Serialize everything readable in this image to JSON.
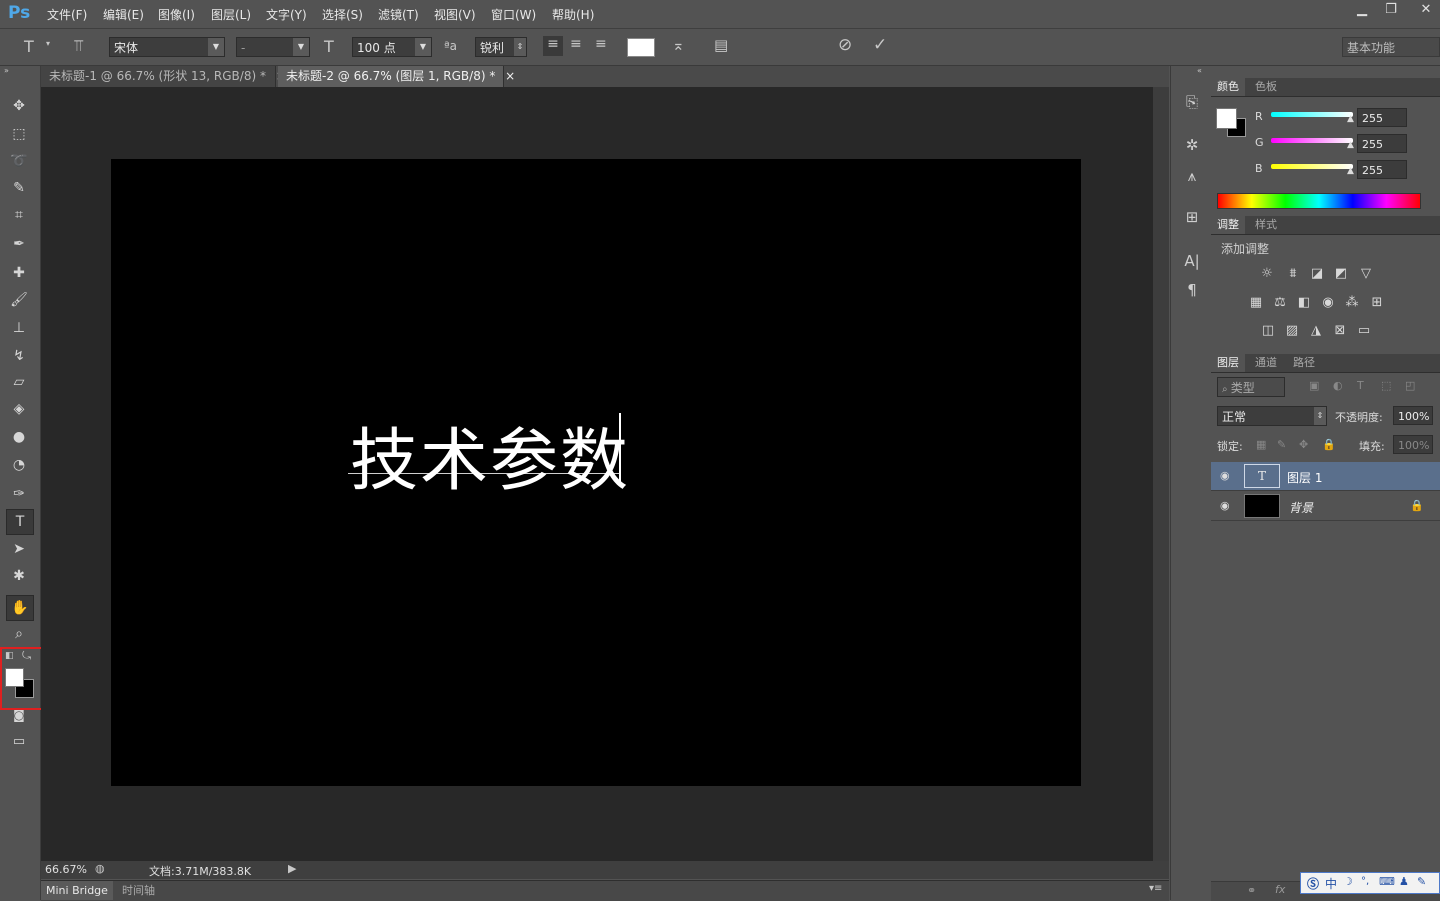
{
  "app": {
    "logo": "Ps"
  },
  "menu": [
    "文件(F)",
    "编辑(E)",
    "图像(I)",
    "图层(L)",
    "文字(Y)",
    "选择(S)",
    "滤镜(T)",
    "视图(V)",
    "窗口(W)",
    "帮助(H)"
  ],
  "window_controls": {
    "minimize": "▁",
    "restore": "❐",
    "close": "✕"
  },
  "options": {
    "font_family": "宋体",
    "font_style": "-",
    "font_size": "100 点",
    "anti_alias_label": "ªa",
    "anti_alias": "锐利",
    "text_color": "#ffffff",
    "workspace": "基本功能"
  },
  "tabs": [
    {
      "label": "未标题-1 @ 66.7% (形状 13, RGB/8) *",
      "close": "×"
    },
    {
      "label": "未标题-2 @ 66.7% (图层 1, RGB/8) *",
      "close": "×"
    }
  ],
  "canvas": {
    "text": "技术参数",
    "background": "#000000"
  },
  "status": {
    "zoom": "66.67%",
    "doc_info": "文档:3.71M/383.8K"
  },
  "bottom_tabs": [
    "Mini Bridge",
    "时间轴"
  ],
  "color_panel": {
    "tabs": [
      "颜色",
      "色板"
    ],
    "foreground": "#ffffff",
    "background": "#000000",
    "channels": [
      {
        "label": "R",
        "value": "255"
      },
      {
        "label": "G",
        "value": "255"
      },
      {
        "label": "B",
        "value": "255"
      }
    ]
  },
  "adjustments_panel": {
    "tabs": [
      "调整",
      "样式"
    ],
    "heading": "添加调整"
  },
  "layers_panel": {
    "tabs": [
      "图层",
      "通道",
      "路径"
    ],
    "filter_label": "类型",
    "blend_mode": "正常",
    "opacity_label": "不透明度:",
    "opacity": "100%",
    "lock_label": "锁定:",
    "fill_label": "填充:",
    "fill": "100%",
    "layers": [
      {
        "name": "图层 1",
        "type": "text",
        "selected": true
      },
      {
        "name": "背景",
        "type": "background",
        "locked": true
      }
    ]
  },
  "ime_toolbar": {
    "label": "中"
  }
}
